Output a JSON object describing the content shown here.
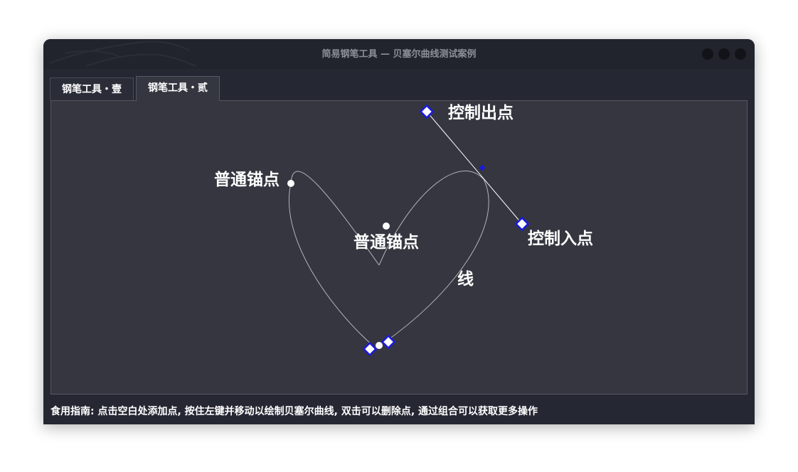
{
  "window": {
    "title": "简易钢笔工具 — 贝塞尔曲线测试案例"
  },
  "tabs": [
    {
      "label": "钢笔工具・壹",
      "active": false
    },
    {
      "label": "钢笔工具・贰",
      "active": true
    }
  ],
  "canvas": {
    "labels": {
      "anchor_left": "普通锚点",
      "anchor_center": "普通锚点",
      "control_out": "控制出点",
      "control_in": "控制入点",
      "line": "线"
    },
    "colors": {
      "curve": "#b4b4b8",
      "handle_line": "#ffffff",
      "control_point_border": "#1a19e0",
      "control_point_fill": "#ffffff",
      "anchor": "#ffffff",
      "background": "#353640"
    }
  },
  "guide": {
    "text": "食用指南: 点击空白处添加点, 按住左键并移动以绘制贝塞尔曲线, 双击可以删除点, 通过组合可以获取更多操作"
  }
}
